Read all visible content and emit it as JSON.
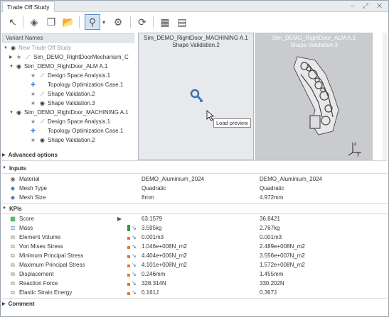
{
  "window": {
    "title": "Trade Off Study",
    "controls": "– ⤢ ✕"
  },
  "toolbar": {
    "icons": [
      "select-arrow-icon",
      "eraser-icon",
      "copy-icon",
      "folder-open-icon",
      "search-preview-icon",
      "dropdown-icon",
      "settings-paint-icon",
      "refresh-icon",
      "table-export-icon",
      "report-export-icon"
    ]
  },
  "variants": {
    "header": "Variant Names",
    "items": [
      {
        "label": "New Trade Off Study",
        "level": 0,
        "icon": "eye"
      },
      {
        "label": "Sim_DEMO_RightDoorMechanism_C",
        "level": 1,
        "icon": "star-pin"
      },
      {
        "label": "Sim_DEMO_RightDoor_ALM A.1",
        "level": 1,
        "icon": "eye"
      },
      {
        "label": "Design Space Analysis.1",
        "level": 2,
        "icon": "star-pin"
      },
      {
        "label": "Topology Optimization Case.1",
        "level": 2,
        "icon": "plus"
      },
      {
        "label": "Shape Validation.2",
        "level": 2,
        "icon": "star-pin"
      },
      {
        "label": "Shape Validation.3",
        "level": 2,
        "icon": "star-eye"
      },
      {
        "label": "Sim_DEMO_RightDoor_MACHINING A.1",
        "level": 1,
        "icon": "eye"
      },
      {
        "label": "Design Space Analysis.1",
        "level": 2,
        "icon": "star-pin"
      },
      {
        "label": "Topology Optimization Case.1",
        "level": 2,
        "icon": "plus"
      },
      {
        "label": "Shape Validation.2",
        "level": 2,
        "icon": "star-eye"
      }
    ]
  },
  "previews": [
    {
      "line1": "Sim_DEMO_RightDoor_MACHINING A.1",
      "line2": "Shape Validation.2"
    },
    {
      "line1": "Sim_DEMO_RightDoor_ALM A.1",
      "line2": "Shape Validation.3"
    }
  ],
  "tooltip": "Load preview",
  "axes": {
    "y": "y",
    "z": "z"
  },
  "sections": {
    "advanced": "Advanced options",
    "inputs": "Inputs",
    "kpis": "KPIs",
    "comment": "Comment"
  },
  "inputs": [
    {
      "label": "Material",
      "v1": "DEMO_Aluminium_2024",
      "v2": "DEMO_Aluminium_2024"
    },
    {
      "label": "Mesh Type",
      "v1": "Quadratic",
      "v2": "Quadratic"
    },
    {
      "label": "Mesh Size",
      "v1": "8mm",
      "v2": "4.972mm"
    }
  ],
  "kpis": [
    {
      "label": "Score",
      "v1": "63.1579",
      "v2": "36.8421"
    },
    {
      "label": "Mass",
      "v1": "3.595kg",
      "v2": "2.767kg"
    },
    {
      "label": "Element Volume",
      "v1": "0.001m3",
      "v2": "0.001m3"
    },
    {
      "label": "Von Mises Stress",
      "v1": "1.046e+008N_m2",
      "v2": "2.489e+008N_m2"
    },
    {
      "label": "Minimum Principal Stress",
      "v1": "4.404e+006N_m2",
      "v2": "3.556e+007N_m2"
    },
    {
      "label": "Maximum Principal Stress",
      "v1": "4.101e+008N_m2",
      "v2": "1.572e+008N_m2"
    },
    {
      "label": "Displacement",
      "v1": "0.246mm",
      "v2": "1.455mm"
    },
    {
      "label": "Reaction Force",
      "v1": "328.314N",
      "v2": "330.202N"
    },
    {
      "label": "Elastic Strain Energy",
      "v1": "0.161J",
      "v2": "0.367J"
    }
  ],
  "colors": {
    "green": "#2e9e3a",
    "orange": "#e07a2a",
    "blue": "#3b6fb5"
  }
}
